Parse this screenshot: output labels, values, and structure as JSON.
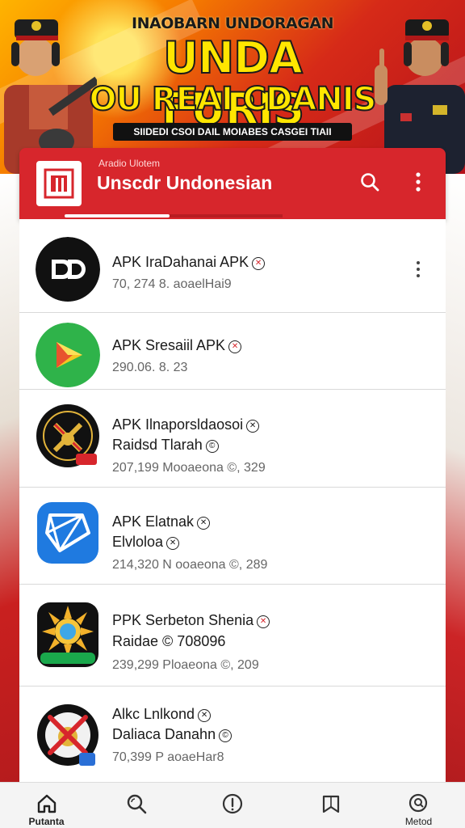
{
  "hero": {
    "small_text": "INAOBARN UNDORAGAN",
    "title_line1": "UNDA FURIS",
    "title_line2": "OU REAI CDANIS",
    "subtitle": "SIIDEDI CSOI DAIL MOIABES CASGEI TIAII"
  },
  "appbar": {
    "subtitle": "Aradio Ulotem",
    "title": "Unscdr Undonesian",
    "logo_icon": "app-logo",
    "search_icon": "search-icon",
    "more_icon": "more-vertical-icon"
  },
  "apps": [
    {
      "name": "APK IraDahanai APK",
      "line2": "",
      "meta": "70, 274 8. aoaelHai9",
      "icon": "dd-logo"
    },
    {
      "name": "APK Sresaiil APK",
      "line2": "",
      "meta": "290.06. 8. 23",
      "icon": "green-play-logo"
    },
    {
      "name": "APK Ilnaporsldaosoi",
      "line2": "Raidsd Tlarah",
      "meta": "207,199 Mooaeona ©, 329",
      "icon": "emblem-logo"
    },
    {
      "name": "APK Elatnak",
      "line2": "Elvloloa",
      "meta": "214,320 N ooaeona ©, 289",
      "icon": "blue-geometric-logo"
    },
    {
      "name": "PPK Serbeton Shenia",
      "line2": "Raidae © 708096",
      "meta": "239,299 Ploaeona ©, 209",
      "icon": "sun-logo"
    },
    {
      "name": "Alkc Lnlkond",
      "line2": "Daliaca Danahn",
      "meta": "70,399 P aoaeHar8",
      "icon": "emblem-cross-logo"
    }
  ],
  "nav": [
    {
      "label": "Putanta",
      "icon": "home-icon"
    },
    {
      "label": "",
      "icon": "search-icon"
    },
    {
      "label": "",
      "icon": "info-icon"
    },
    {
      "label": "",
      "icon": "bookmark-icon"
    },
    {
      "label": "Metod",
      "icon": "search-circle-icon"
    }
  ],
  "colors": {
    "primary": "#d7262c",
    "hero_yellow": "#ffe600",
    "background": "#ffffff"
  }
}
